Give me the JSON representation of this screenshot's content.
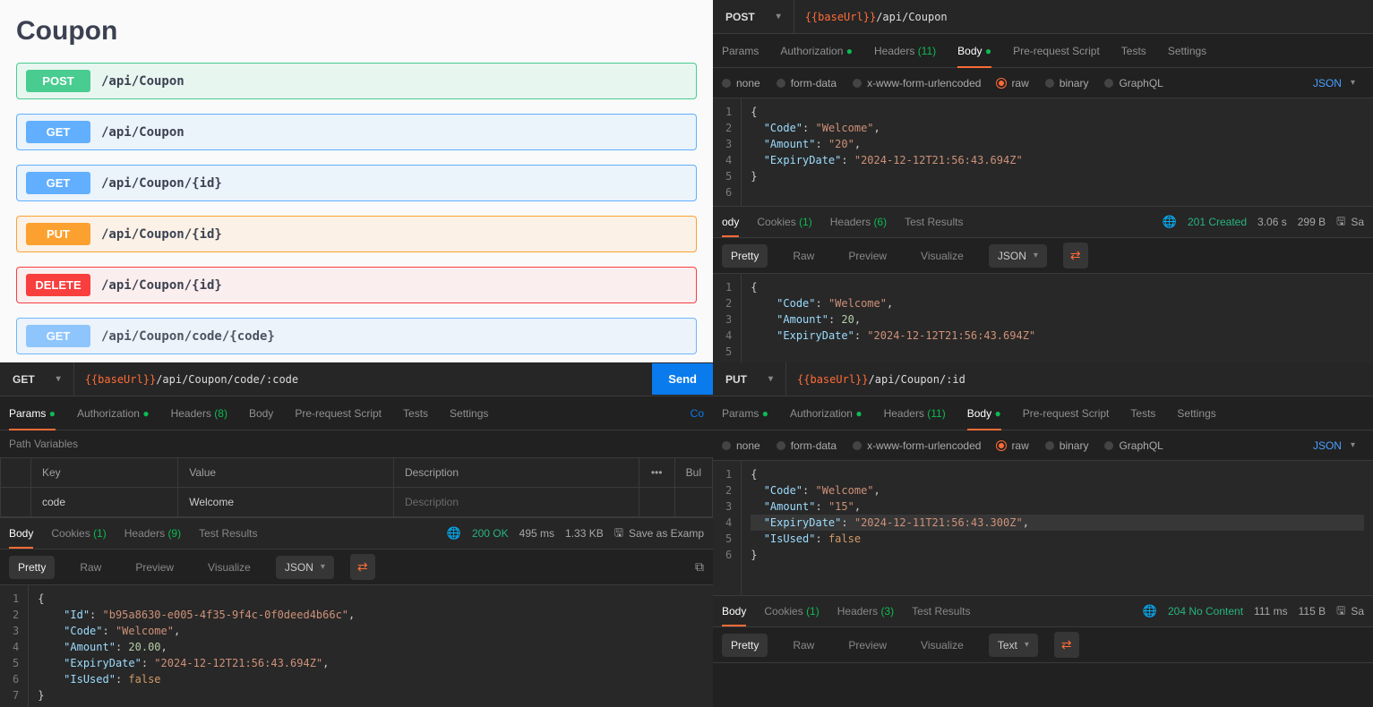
{
  "swagger": {
    "title": "Coupon",
    "endpoints": [
      {
        "method": "POST",
        "path": "/api/Coupon",
        "methodClass": "m-post",
        "rowClass": "ep-post"
      },
      {
        "method": "GET",
        "path": "/api/Coupon",
        "methodClass": "m-get",
        "rowClass": "ep-get"
      },
      {
        "method": "GET",
        "path": "/api/Coupon/{id}",
        "methodClass": "m-get",
        "rowClass": "ep-get"
      },
      {
        "method": "PUT",
        "path": "/api/Coupon/{id}",
        "methodClass": "m-put",
        "rowClass": "ep-put"
      },
      {
        "method": "DELETE",
        "path": "/api/Coupon/{id}",
        "methodClass": "m-del",
        "rowClass": "ep-del"
      },
      {
        "method": "GET",
        "path": "/api/Coupon/code/{code}",
        "methodClass": "m-get2",
        "rowClass": "ep-get2"
      }
    ]
  },
  "postman_tr": {
    "method": "POST",
    "url_var": "{{baseUrl}}",
    "url_rest": "/api/Coupon",
    "tabs": {
      "params": "Params",
      "auth": "Authorization",
      "headers": "Headers",
      "headers_count": "(11)",
      "body": "Body",
      "prereq": "Pre-request Script",
      "tests": "Tests",
      "settings": "Settings"
    },
    "radios": {
      "none": "none",
      "form": "form-data",
      "xwww": "x-www-form-urlencoded",
      "raw": "raw",
      "binary": "binary",
      "graphql": "GraphQL",
      "json": "JSON"
    },
    "req_body": {
      "1": "{",
      "2k": "\"Code\"",
      "2v": "\"Welcome\"",
      "3k": "\"Amount\"",
      "3v": "\"20\"",
      "4k": "\"ExpiryDate\"",
      "4v": "\"2024-12-12T21:56:43.694Z\"",
      "5": "}"
    },
    "resp": {
      "tabs": {
        "body": "ody",
        "cookies": "Cookies",
        "cookies_count": "(1)",
        "headers": "Headers",
        "headers_count": "(6)",
        "tests": "Test Results"
      },
      "status": "201 Created",
      "time": "3.06 s",
      "size": "299 B",
      "save": "Sa",
      "view": {
        "pretty": "Pretty",
        "raw": "Raw",
        "preview": "Preview",
        "visualize": "Visualize",
        "json": "JSON"
      },
      "body": {
        "1": "{",
        "2k": "\"Code\"",
        "2v": "\"Welcome\"",
        "3k": "\"Amount\"",
        "3v": "20",
        "4k": "\"ExpiryDate\"",
        "4v": "\"2024-12-12T21:56:43.694Z\"",
        "5": ""
      }
    }
  },
  "postman_bl": {
    "method": "GET",
    "url_var": "{{baseUrl}}",
    "url_rest": "/api/Coupon/code/:code",
    "send": "Send",
    "tabs": {
      "params": "Params",
      "auth": "Authorization",
      "headers": "Headers",
      "headers_count": "(8)",
      "body": "Body",
      "prereq": "Pre-request Script",
      "tests": "Tests",
      "settings": "Settings",
      "cookies": "Co"
    },
    "pathvars_label": "Path Variables",
    "table": {
      "hkey": "Key",
      "hval": "Value",
      "hdesc": "Description",
      "bulk": "Bul",
      "key": "code",
      "val": "Welcome",
      "desc_ph": "Description"
    },
    "resp": {
      "tabs": {
        "body": "Body",
        "cookies": "Cookies",
        "cookies_count": "(1)",
        "headers": "Headers",
        "headers_count": "(9)",
        "tests": "Test Results"
      },
      "status": "200 OK",
      "time": "495 ms",
      "size": "1.33 KB",
      "save": "Save as Examp",
      "view": {
        "pretty": "Pretty",
        "raw": "Raw",
        "preview": "Preview",
        "visualize": "Visualize",
        "json": "JSON"
      },
      "body": {
        "1": "{",
        "2k": "\"Id\"",
        "2v": "\"b95a8630-e005-4f35-9f4c-0f0deed4b66c\"",
        "3k": "\"Code\"",
        "3v": "\"Welcome\"",
        "4k": "\"Amount\"",
        "4v": "20.00",
        "5k": "\"ExpiryDate\"",
        "5v": "\"2024-12-12T21:56:43.694Z\"",
        "6k": "\"IsUsed\"",
        "6v": "false",
        "7": "}"
      }
    }
  },
  "postman_br": {
    "method": "PUT",
    "url_var": "{{baseUrl}}",
    "url_rest": "/api/Coupon/:id",
    "tabs": {
      "params": "Params",
      "auth": "Authorization",
      "headers": "Headers",
      "headers_count": "(11)",
      "body": "Body",
      "prereq": "Pre-request Script",
      "tests": "Tests",
      "settings": "Settings"
    },
    "radios": {
      "none": "none",
      "form": "form-data",
      "xwww": "x-www-form-urlencoded",
      "raw": "raw",
      "binary": "binary",
      "graphql": "GraphQL",
      "json": "JSON"
    },
    "req_body": {
      "1": "{",
      "2k": "\"Code\"",
      "2v": "\"Welcome\"",
      "3k": "\"Amount\"",
      "3v": "\"15\"",
      "4k": "\"ExpiryDate\"",
      "4v": "\"2024-12-11T21:56:43.300Z\"",
      "5k": "\"IsUsed\"",
      "5v": "false",
      "6": "}"
    },
    "resp": {
      "tabs": {
        "body": "Body",
        "cookies": "Cookies",
        "cookies_count": "(1)",
        "headers": "Headers",
        "headers_count": "(3)",
        "tests": "Test Results"
      },
      "status": "204 No Content",
      "time": "111 ms",
      "size": "115 B",
      "save": "Sa",
      "view": {
        "pretty": "Pretty",
        "raw": "Raw",
        "preview": "Preview",
        "visualize": "Visualize",
        "text": "Text"
      }
    }
  }
}
